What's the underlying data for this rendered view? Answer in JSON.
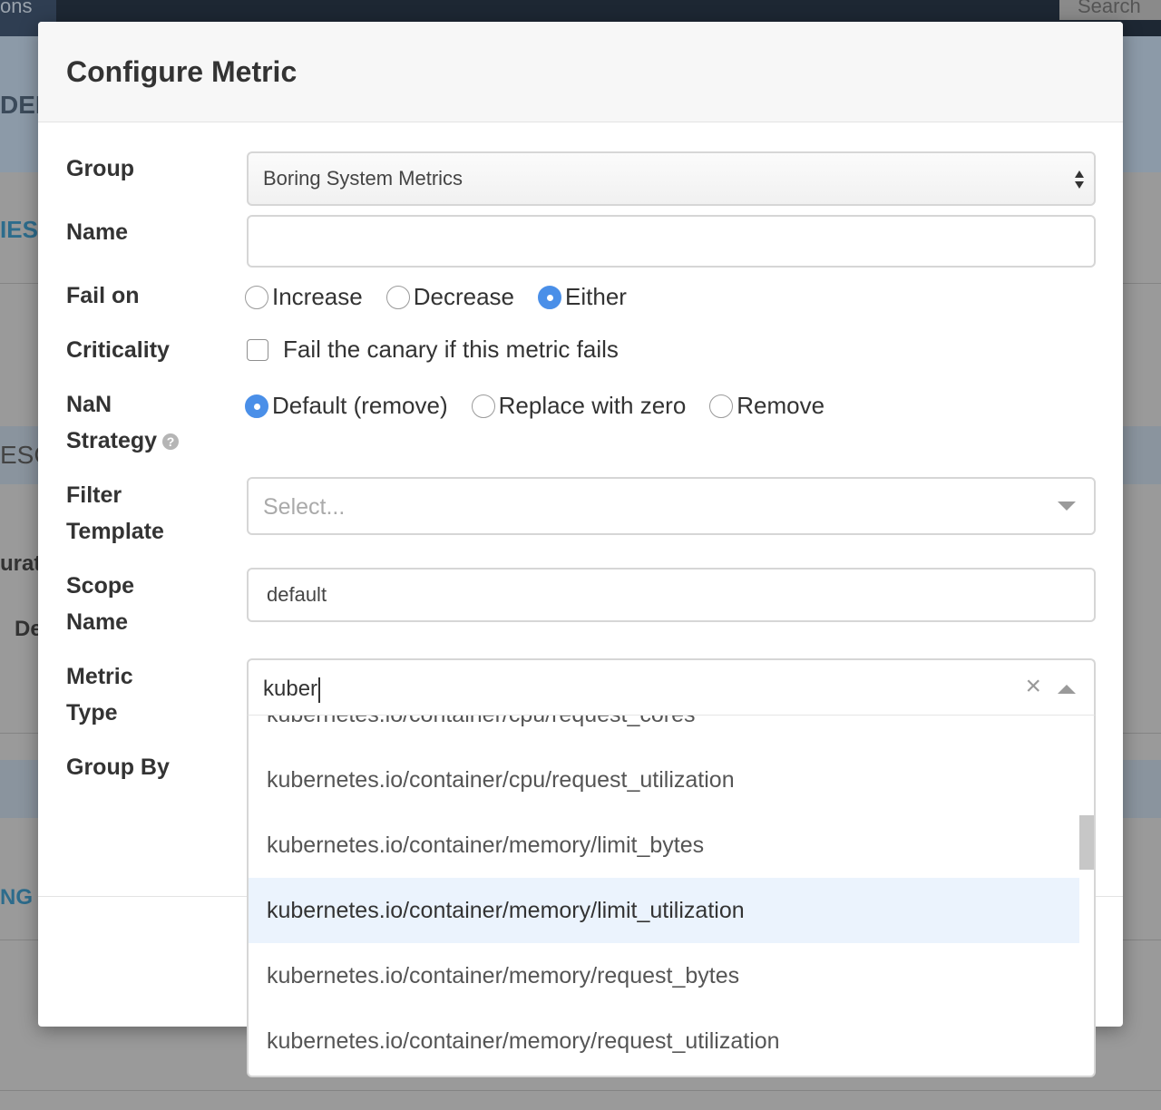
{
  "background": {
    "topbar_tab_text": "ons",
    "search_label": "Search",
    "fragments": [
      "DEL",
      "IES",
      "ESC",
      "urat",
      "De",
      "NG"
    ]
  },
  "modal": {
    "title": "Configure Metric"
  },
  "form": {
    "group": {
      "label": "Group",
      "value": "Boring System Metrics"
    },
    "name": {
      "label": "Name",
      "value": ""
    },
    "fail_on": {
      "label": "Fail on",
      "options": [
        "Increase",
        "Decrease",
        "Either"
      ],
      "selected": "Either"
    },
    "criticality": {
      "label": "Criticality",
      "checkbox_label": "Fail the canary if this metric fails",
      "checked": false
    },
    "nan_strategy": {
      "label_line1": "NaN",
      "label_line2": "Strategy",
      "options": [
        "Default (remove)",
        "Replace with zero",
        "Remove"
      ],
      "selected": "Default (remove)"
    },
    "filter_template": {
      "label_line1": "Filter",
      "label_line2": "Template",
      "placeholder": "Select..."
    },
    "scope_name": {
      "label_line1": "Scope",
      "label_line2": "Name",
      "value": "default"
    },
    "metric_type": {
      "label_line1": "Metric",
      "label_line2": "Type",
      "input_value": "kuber",
      "clear_glyph": "×",
      "options": [
        "kubernetes.io/container/cpu/request_cores",
        "kubernetes.io/container/cpu/request_utilization",
        "kubernetes.io/container/memory/limit_bytes",
        "kubernetes.io/container/memory/limit_utilization",
        "kubernetes.io/container/memory/request_bytes",
        "kubernetes.io/container/memory/request_utilization"
      ],
      "highlighted": "kubernetes.io/container/memory/limit_utilization"
    },
    "group_by": {
      "label": "Group By"
    }
  },
  "colors": {
    "accent": "#4a8fe8",
    "highlight_bg": "#ebf3fd"
  }
}
